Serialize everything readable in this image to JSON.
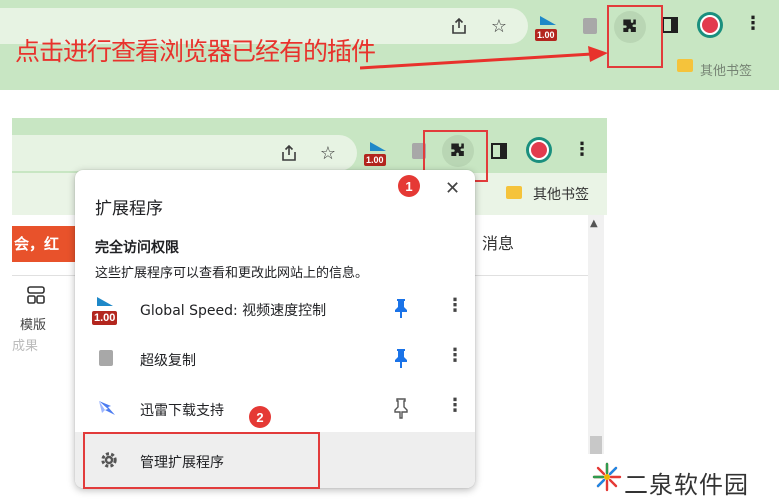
{
  "top_caption": "点击进行查看浏览器已经有的插件",
  "top_bookmark": "其他书签",
  "speed_badge": "1.00",
  "menu": {
    "title": "扩展程序",
    "close": "✕",
    "subheading": "完全访问权限",
    "description": "这些扩展程序可以查看和更改此网站上的信息。",
    "extensions": [
      {
        "name": "Global Speed: 视频速度控制",
        "pinned": true,
        "icon": "speed-icon"
      },
      {
        "name": "超级复制",
        "pinned": true,
        "icon": "book-icon"
      },
      {
        "name": "迅雷下载支持",
        "pinned": false,
        "icon": "thunder-icon"
      }
    ],
    "manage": "管理扩展程序"
  },
  "page": {
    "bookmark": "其他书签",
    "banner": "会，红",
    "news_tab": "消息",
    "template_label": "模版",
    "faded_label": "成果"
  },
  "step_badges": [
    "1",
    "2"
  ],
  "watermark": "二泉软件园",
  "colors": {
    "toolbar": "#c8e6c3",
    "annotation_red": "#e23b3b",
    "pin_blue": "#1a73e8"
  }
}
